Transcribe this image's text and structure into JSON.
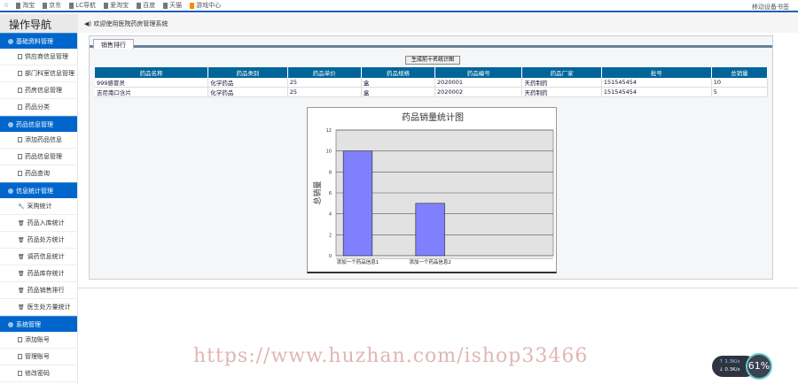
{
  "bookmarks": [
    "淘宝",
    "京东",
    "LC导航",
    "爱淘宝",
    "百度",
    "天猫",
    "游戏中心"
  ],
  "bookmark_right": "移动设备书签",
  "header": {
    "title": "操作导航",
    "welcome": "欢迎使用医院药房管理系统"
  },
  "sidebar": [
    {
      "label": "基础资料管理",
      "items": [
        "供应商信息管理",
        "部门科室信息管理",
        "药房信息管理",
        "药品分类"
      ]
    },
    {
      "label": "药品信息管理",
      "items": [
        "添加药品信息",
        "药品信息管理",
        "药品查询"
      ]
    },
    {
      "label": "信息统计管理",
      "items": [
        "采购统计",
        "药品入库统计",
        "药品处方统计",
        "调药信息统计",
        "药品库存统计",
        "药品销售排行",
        "医生处方量统计"
      ]
    },
    {
      "label": "系统管理",
      "items": [
        "添加账号",
        "管理账号",
        "修改密码"
      ]
    }
  ],
  "tab": "销售排行",
  "gen_button": "生成前十名统计图",
  "table": {
    "headers": [
      "药品名称",
      "药品类别",
      "药品单价",
      "药品规格",
      "药品编号",
      "药品厂家",
      "批号",
      "总销量"
    ],
    "rows": [
      [
        "999感冒灵",
        "化学药品",
        "25",
        "盒",
        "2020001",
        "天药制药",
        "151545454",
        "10"
      ],
      [
        "吉尼南口含片",
        "化学药品",
        "25",
        "盒",
        "2020002",
        "天药制药",
        "151545454",
        "5"
      ]
    ]
  },
  "chart_data": {
    "type": "bar",
    "title": "药品销量统计图",
    "ylabel": "总销量",
    "xlabel": "",
    "categories": [
      "添加一个药品信息1",
      "添加一个药品信息2"
    ],
    "values": [
      10,
      5
    ],
    "ylim": [
      0,
      12
    ],
    "yticks": [
      0,
      2,
      4,
      6,
      8,
      10,
      12
    ],
    "bar_color": "#8080ff",
    "grid": true
  },
  "watermark": "https://www.huzhan.com/ishop33466",
  "net": {
    "up": "1.3K/s",
    "down": "0.3K/s",
    "cpu": "61%"
  }
}
